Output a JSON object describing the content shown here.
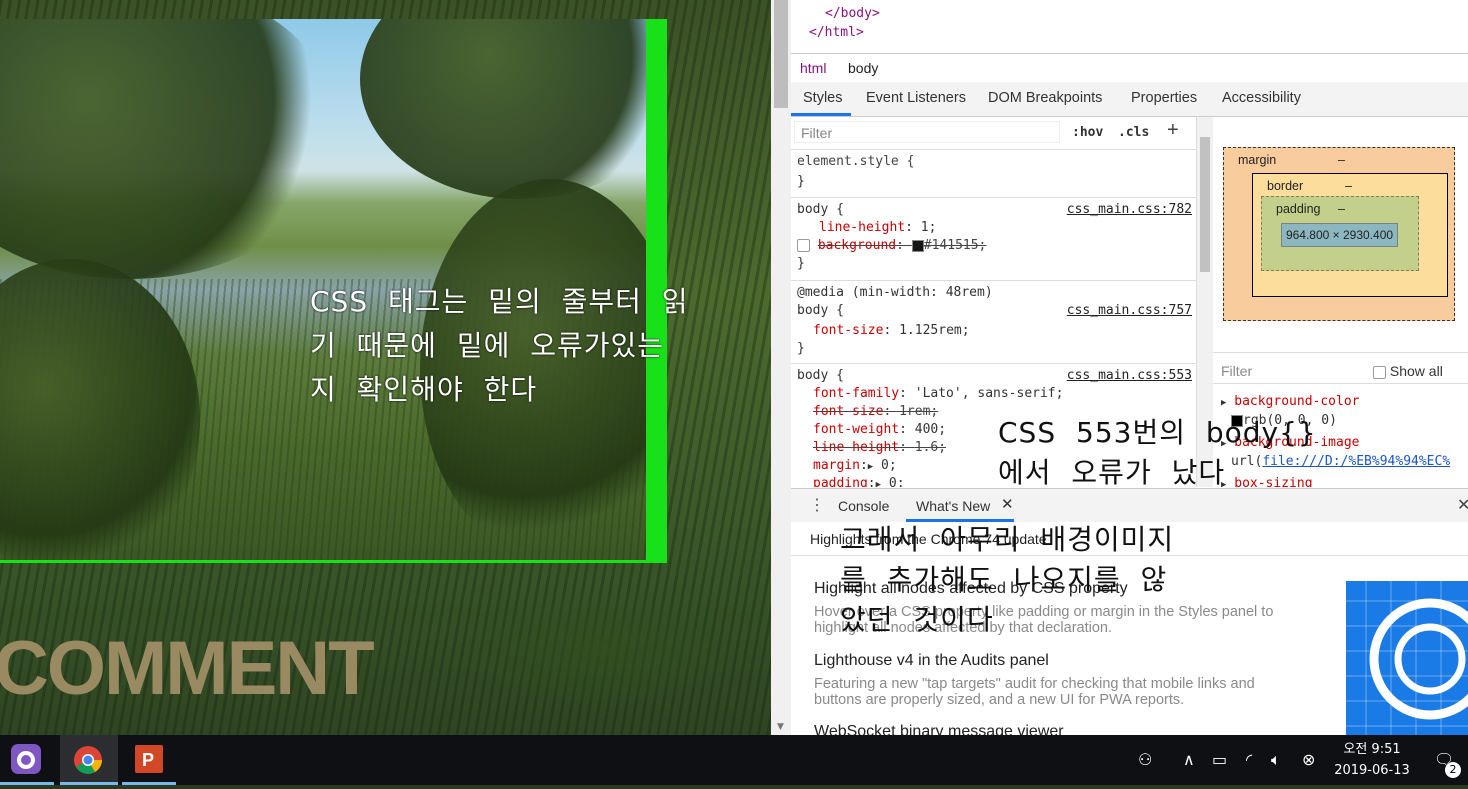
{
  "page": {
    "annotation1": [
      "CSS 태그는 밑의 줄부터 읽",
      "기 때문에 밑에 오류가있는",
      "지 확인해야 한다"
    ],
    "comment_heading": "COMMENT"
  },
  "devtools": {
    "dom_lines": [
      "</body>",
      "</html>"
    ],
    "breadcrumbs": [
      "html",
      "body"
    ],
    "tabs": [
      "Styles",
      "Event Listeners",
      "DOM Breakpoints",
      "Properties",
      "Accessibility"
    ],
    "active_tab": "Styles",
    "styles_filter_placeholder": "Filter",
    "hov_label": ":hov",
    "cls_label": ".cls",
    "element_style": [
      "element.style {",
      "}"
    ],
    "rule1": {
      "selector": "body {",
      "source": "css_main.css:782",
      "line_height_prop": "line-height",
      "line_height_val": "1;",
      "background_prop": "background",
      "background_val": "#141515;",
      "close": "}"
    },
    "rule2": {
      "media": "@media (min-width: 48rem)",
      "selector": "body {",
      "source": "css_main.css:757",
      "prop": "font-size",
      "val": "1.125rem;",
      "close": "}"
    },
    "rule3": {
      "selector": "body {",
      "source": "css_main.css:553",
      "props": [
        {
          "p": "font-family",
          "v": "'Lato', sans-serif;",
          "strike": false
        },
        {
          "p": "font-size",
          "v": "1rem;",
          "strike": true
        },
        {
          "p": "font-weight",
          "v": "400;",
          "strike": false
        },
        {
          "p": "line-height",
          "v": "1.6;",
          "strike": true
        },
        {
          "p": "margin",
          "v": "0;",
          "strike": false
        },
        {
          "p": "padding",
          "v": "0;",
          "strike": false
        }
      ]
    },
    "boxmodel": {
      "margin": "margin",
      "border": "border",
      "padding": "padding",
      "dash": "–",
      "content": "964.800 × 2930.400"
    },
    "computed_filter_placeholder": "Filter",
    "show_all": "Show all",
    "computed": [
      {
        "prop": "background-color",
        "val": "rgb(0, 0, 0)"
      },
      {
        "prop": "background-image",
        "val": "url(file:///D:/%EB%94%94%EC%"
      },
      {
        "prop": "box-sizing",
        "val": ""
      }
    ],
    "url_prefix": "url(",
    "url_link": "file:///D:/%EB%94%94%EC%",
    "drawer_tabs": [
      "Console",
      "What's New"
    ],
    "whats_new": {
      "highlights": "Highlights from the Chrome 74 update",
      "items": [
        {
          "title": "Highlight all nodes affected by CSS property",
          "desc": "Hover over a CSS property like padding or margin in the Styles panel to highlight all nodes affected by that declaration."
        },
        {
          "title": "Lighthouse v4 in the Audits panel",
          "desc": "Featuring a new \"tap targets\" audit for checking that mobile links and buttons are properly sized, and a new UI for PWA reports."
        },
        {
          "title": "WebSocket binary message viewer",
          "desc": ""
        }
      ]
    }
  },
  "annotation2": [
    "CSS 553번의 body{}",
    "에서 오류가 났다"
  ],
  "annotation3": [
    "그래서 아무리 배경이미지",
    "를 추가해도 나오지를 않",
    "았던 것이다"
  ],
  "taskbar": {
    "time": "오전 9:51",
    "date": "2019-06-13",
    "notification_count": "2",
    "apps": [
      "github-desktop",
      "chrome",
      "powerpoint"
    ]
  }
}
